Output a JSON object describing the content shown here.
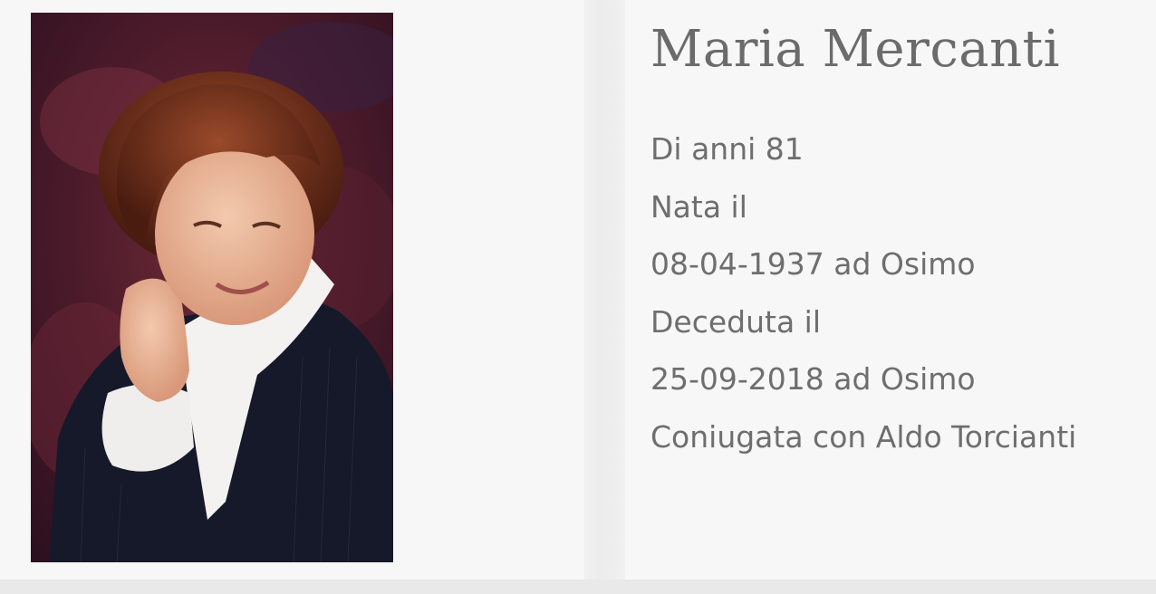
{
  "person": {
    "name": "Maria Mercanti",
    "details": [
      "Di anni 81",
      "Nata il",
      "08-04-1937 ad Osimo",
      "Deceduta il",
      "25-09-2018 ad Osimo",
      "Coniugata con Aldo Torcianti"
    ]
  },
  "colors": {
    "text": "#6e6e6e",
    "background": "#f7f7f7"
  }
}
